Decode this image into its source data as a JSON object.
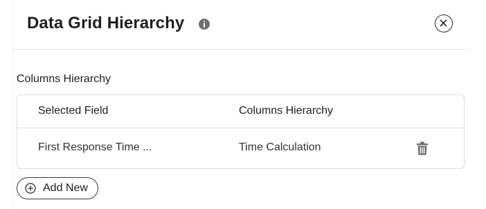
{
  "dialog": {
    "title": "Data Grid Hierarchy",
    "info_icon": "info-icon",
    "close_icon": "close-icon"
  },
  "section": {
    "label": "Columns Hierarchy"
  },
  "table": {
    "columns": [
      "Selected Field",
      "Columns Hierarchy"
    ],
    "rows": [
      {
        "selected_field": "First Response Time ...",
        "columns_hierarchy": "Time Calculation",
        "action_icon": "trash-icon"
      }
    ]
  },
  "actions": {
    "add_label": "Add New",
    "add_icon": "plus-circle-icon"
  },
  "colors": {
    "text": "#1f1f24",
    "border": "#dcdcdc",
    "icon": "#707070"
  }
}
